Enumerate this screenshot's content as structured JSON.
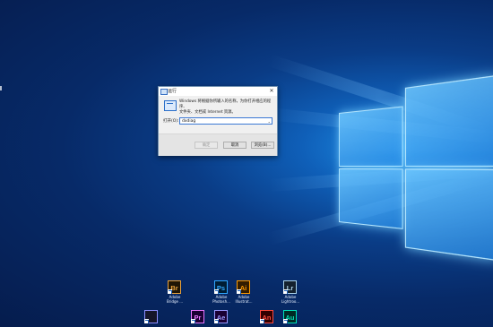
{
  "run_dialog": {
    "title": "运行",
    "close_glyph": "✕",
    "description_line1": "Windows 将根据你所输入的名称，为你打开相应的程序、",
    "description_line2": "文件夹、文档或 Internet 资源。",
    "open_label": "打开(O):",
    "open_value": "dxdiag",
    "dropdown_glyph": "⌄",
    "ok_label": "确定",
    "cancel_label": "取消",
    "browse_label": "浏览(B)..."
  },
  "desktop": {
    "icons_row1": [
      {
        "abbr": "Br",
        "label1": "Adobe",
        "label2": "Bridge ...",
        "bg": "#1f1505",
        "fg": "#e9a23b"
      },
      {
        "abbr": "Ps",
        "label1": "Adobe",
        "label2": "Photosh...",
        "bg": "#001d34",
        "fg": "#31a8ff"
      },
      {
        "abbr": "Ai",
        "label1": "Adobe",
        "label2": "Illustrat...",
        "bg": "#331c00",
        "fg": "#ff9a00"
      },
      {
        "abbr": "Lr",
        "label1": "Adobe",
        "label2": "Lightroo...",
        "bg": "#14212e",
        "fg": "#add5ec"
      }
    ],
    "icons_row2": [
      {
        "abbr": "",
        "bg": "#16162a",
        "fg": "#8f8fff"
      },
      {
        "abbr": "Pr",
        "bg": "#1a0033",
        "fg": "#ea77ff"
      },
      {
        "abbr": "Ae",
        "bg": "#1a0033",
        "fg": "#9999ff"
      },
      {
        "abbr": "An",
        "bg": "#330000",
        "fg": "#ff4a3d"
      },
      {
        "abbr": "Au",
        "bg": "#002924",
        "fg": "#00e4bb"
      }
    ]
  }
}
